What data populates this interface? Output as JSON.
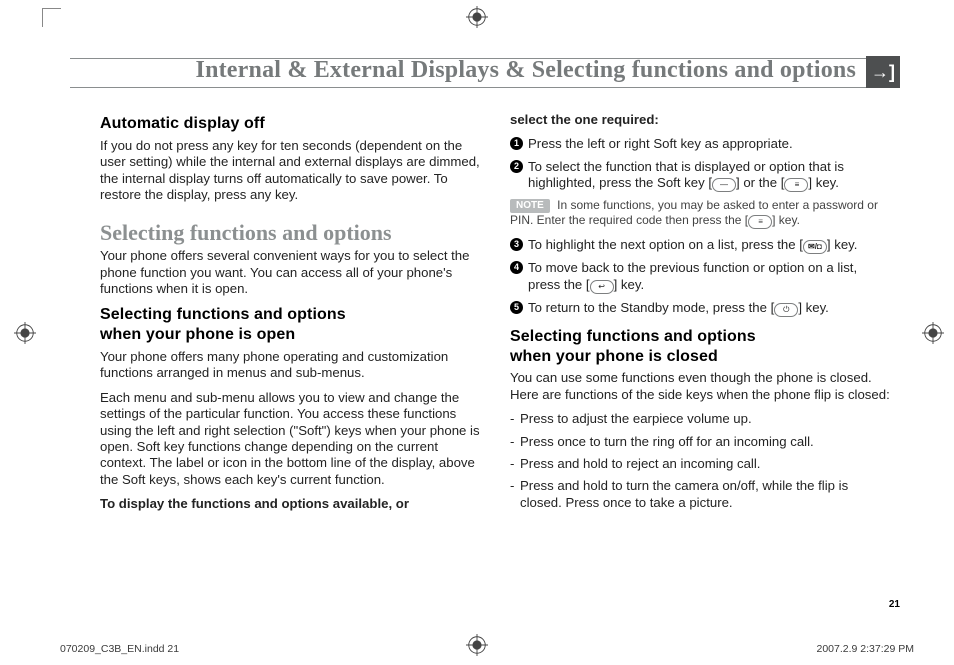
{
  "header": {
    "title": "Internal & External Displays & Selecting functions and options"
  },
  "left": {
    "auto_off_heading": "Automatic display off",
    "auto_off_body": "If you do not press any key for ten seconds (dependent on the user setting) while the internal and external displays are dimmed, the internal display turns off automatically to save power. To restore the display, press any key.",
    "select_heading": "Selecting functions and options",
    "select_intro": "Your phone offers several convenient ways for you to select the phone function you want. You can access all of your phone's functions when it is open.",
    "open_heading1": "Selecting functions and options",
    "open_heading2": "when your phone is open",
    "open_p1": "Your phone offers many phone operating and customization functions arranged in menus and sub-menus.",
    "open_p2": "Each menu and sub-menu allows you to view and change the settings of the particular function. You access these functions using the left and right selection (\"Soft\") keys when your phone is open. Soft key functions change depending on the current context. The label or icon in the bottom line of the display, above the Soft keys, shows each key's current function.",
    "open_lead": "To display the functions and options available, or "
  },
  "right": {
    "continue_heading": "select the one required:",
    "steps": {
      "1": "Press the left or right Soft key as appropriate.",
      "2a": "To select the function that is displayed or option that is highlighted, press the Soft key [",
      "2b": "] or the [",
      "2c": "] key.",
      "3a": "To highlight the next option on a list, press the [",
      "3b": "] key.",
      "4a": "To move back to the previous function or option on a list, press the [",
      "4b": "] key.",
      "5a": "To return to the Standby mode, press the [",
      "5b": "] key."
    },
    "note_label": "NOTE",
    "note_a": " In some functions, you may be asked to enter a password or PIN. Enter the required code then press the [",
    "note_b": "] key.",
    "closed_heading1": "Selecting functions and options",
    "closed_heading2": "when your phone is closed",
    "closed_intro": "You can use some functions even though the phone is closed. Here are functions of the side keys when the phone flip is closed:",
    "closed_items": {
      "0": "Press to adjust the earpiece volume up.",
      "1": "Press once to turn the ring off for an incoming call.",
      "2": "Press and hold to reject an incoming call.",
      "3": "Press and hold to turn the camera on/off, while the flip is closed. Press once to take a picture."
    }
  },
  "page_number": "21",
  "footer": {
    "file": "070209_C3B_EN.indd   21",
    "timestamp": "2007.2.9   2:37:29 PM"
  },
  "keys": {
    "soft_dash": "—",
    "menu_bars": "≡",
    "msg_camera": "✉/◘",
    "cancel": "↩",
    "end": "⏻"
  }
}
